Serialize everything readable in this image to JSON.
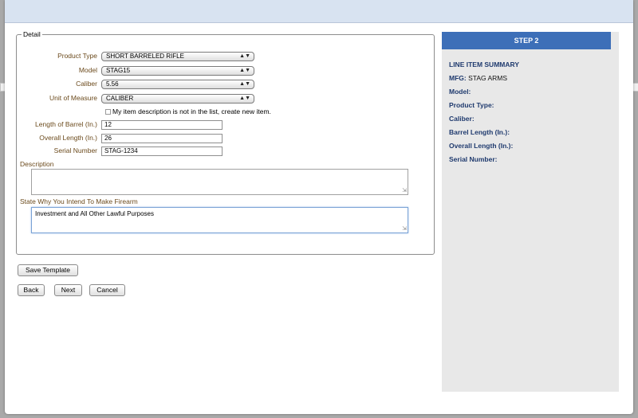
{
  "detail": {
    "legend": "Detail",
    "product_type": {
      "label": "Product Type",
      "value": "SHORT BARRELED RIFLE"
    },
    "model": {
      "label": "Model",
      "value": "STAG15"
    },
    "caliber": {
      "label": "Caliber",
      "value": "5.56"
    },
    "unit_of_measure": {
      "label": "Unit of Measure",
      "value": "CALIBER"
    },
    "new_item_checkbox_label": "My item description is not in the list, create new item.",
    "barrel_length": {
      "label": "Length of Barrel (In.)",
      "value": "12"
    },
    "overall_length": {
      "label": "Overall Length (In.)",
      "value": "26"
    },
    "serial_number": {
      "label": "Serial Number",
      "value": "STAG-1234"
    },
    "description": {
      "label": "Description",
      "value": ""
    },
    "intent": {
      "label": "State Why You Intend To Make Firearm",
      "value": "Investment and All Other Lawful Purposes"
    }
  },
  "buttons": {
    "save_template": "Save Template",
    "back": "Back",
    "next": "Next",
    "cancel": "Cancel"
  },
  "summary": {
    "step": "STEP 2",
    "title": "LINE ITEM SUMMARY",
    "mfg_label": "MFG:",
    "mfg_value": "STAG ARMS",
    "model_label": "Model:",
    "product_type_label": "Product Type:",
    "caliber_label": "Caliber:",
    "barrel_length_label": "Barrel Length (In.):",
    "overall_length_label": "Overall Length (In.):",
    "serial_number_label": "Serial Number:"
  },
  "icons": {
    "select_arrow": "up-down-arrows-icon",
    "resize_grip": "resize-grip-icon"
  },
  "colors": {
    "step_header": "#3d6fb8",
    "summary_text": "#1f3a6e",
    "field_label": "#6b4a1c",
    "panel_bg": "#e8e8e8"
  }
}
